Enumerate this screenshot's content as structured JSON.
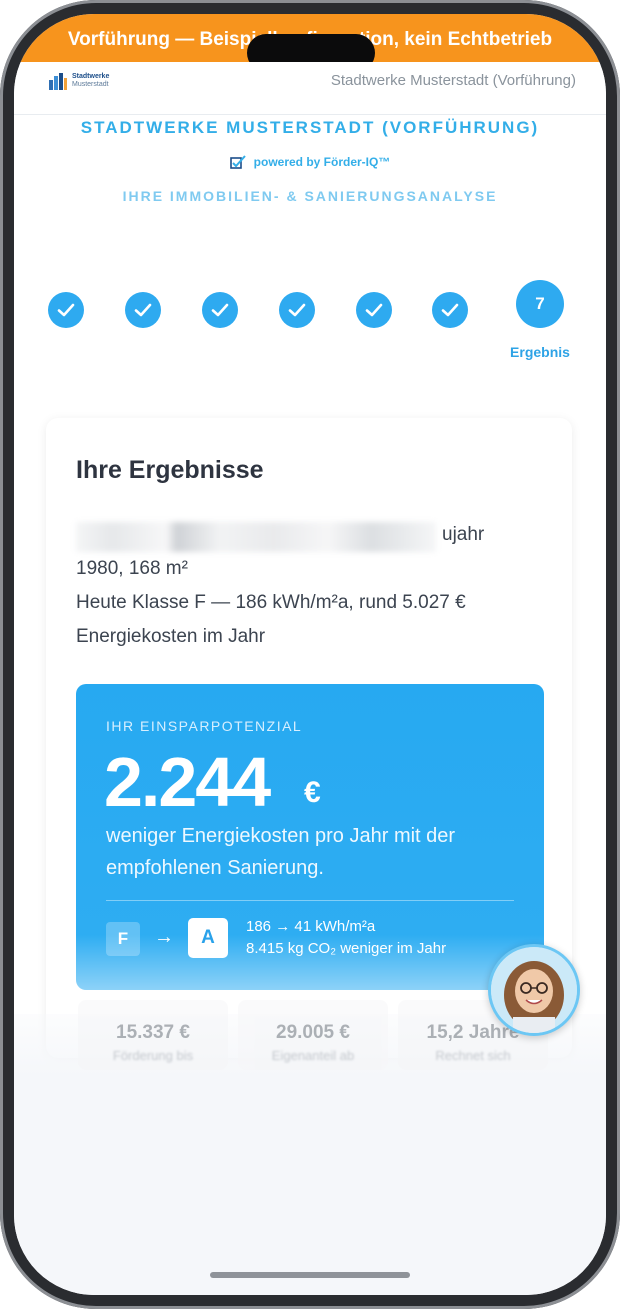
{
  "demo_banner": "Vorführung — Beispielkonfiguration, kein Echtbetrieb",
  "header": {
    "logo_line1": "Stadtwerke",
    "logo_line2": "Musterstadt",
    "right_text": "Stadtwerke Musterstadt (Vorführung)"
  },
  "brand": {
    "title": "STADTWERKE MUSTERSTADT (VORFÜHRUNG)",
    "powered_by": "powered by Förder-IQ™",
    "subtitle": "IHRE IMMOBILIEN- & SANIERUNGSANALYSE"
  },
  "stepper": {
    "completed_steps": 6,
    "current_step_number": "7",
    "current_step_label": "Ergebnis"
  },
  "results": {
    "title": "Ihre Ergebnisse",
    "property_line1_visible": "ujahr",
    "property_line2": "1980, 168 m²",
    "property_line3": "Heute Klasse F — 186 kWh/m²a, rund 5.027 €",
    "property_line4": "Energiekosten im Jahr",
    "savings": {
      "label": "IHR EINSPARPOTENZIAL",
      "amount": "2.244",
      "currency": "€",
      "description": "weniger Energiekosten pro Jahr mit der empfohlenen Sanierung.",
      "class_from": "F",
      "class_to": "A",
      "energy_change": "186 → 41 kWh/m²a",
      "co2_change": "8.415 kg CO₂ weniger im Jahr"
    },
    "stats": [
      {
        "value": "15.337 €",
        "label": "Förderung bis"
      },
      {
        "value": "29.005 €",
        "label": "Eigenanteil ab"
      },
      {
        "value": "15,2 Jahre",
        "label": "Rechnet sich"
      }
    ]
  },
  "colors": {
    "accent": "#2eaaf0",
    "banner": "#f7941d",
    "text_dark": "#2e3440"
  }
}
